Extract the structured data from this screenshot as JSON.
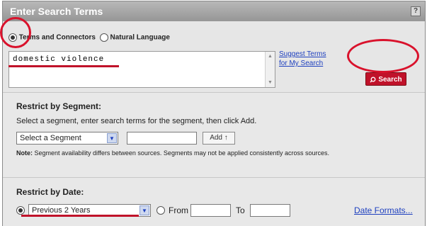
{
  "panel": {
    "title": "Enter Search Terms",
    "help_label": "?"
  },
  "search_mode": {
    "option1_label": "Terms and Connectors",
    "option1_selected": true,
    "option2_label": "Natural Language",
    "option2_selected": false
  },
  "search": {
    "query": "domestic violence",
    "suggest_link_line1": "Suggest Terms",
    "suggest_link_line2": "for My Search",
    "button_label": "Search",
    "button_icon": "search-icon"
  },
  "segment": {
    "title": "Restrict by Segment:",
    "description": "Select a segment, enter search terms for the segment, then click Add.",
    "select_value": "Select a Segment",
    "input_value": "",
    "add_label": "Add ↑",
    "note_label": "Note:",
    "note_text": " Segment availability differs between sources. Segments may not be applied consistently across sources."
  },
  "date": {
    "title": "Restrict by Date:",
    "preset_selected": true,
    "preset_value": "Previous 2 Years",
    "from_label": "From",
    "from_value": "",
    "to_label": "To",
    "to_value": "",
    "formats_link": "Date Formats..."
  },
  "colors": {
    "accent_red": "#c0122a",
    "link_blue": "#1d3fbf",
    "title_bar": "#a8a8a8"
  }
}
